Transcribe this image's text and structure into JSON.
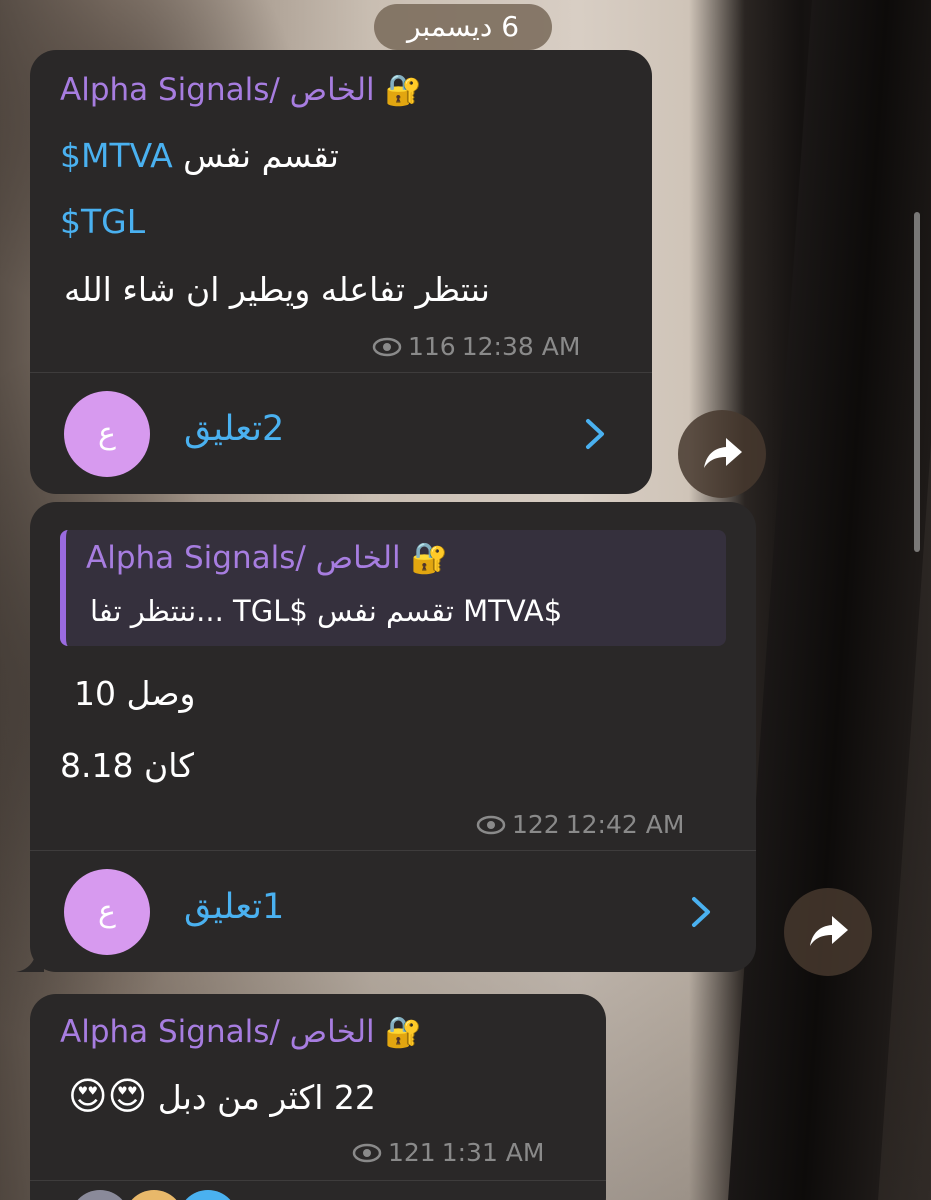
{
  "date_label": "6 ديسمبر",
  "messages": [
    {
      "sender": "Alpha Signals/ الخاص",
      "lines": [
        "تقسم نفس",
        "$MTVA",
        "$TGL",
        "ننتظر تفاعله ويطير ان شاء الله"
      ],
      "views": "116",
      "time": "12:38 AM",
      "comments_label": "2تعليق",
      "avatar_letter": "ع"
    },
    {
      "reply_sender": "Alpha Signals/ الخاص",
      "reply_text": "$MTVA تقسم نفس $TGL ...ننتظر تفا",
      "lines": [
        "وصل 10",
        "كان 8.18"
      ],
      "views": "122",
      "time": "12:42 AM",
      "comments_label": "1تعليق",
      "avatar_letter": "ع"
    },
    {
      "sender": "Alpha Signals/ الخاص",
      "text": "22 اكثر من دبل",
      "emoji": "😍😍",
      "views": "121",
      "time": "1:31 AM"
    }
  ],
  "icons": {
    "lock": "lock-with-key-icon",
    "eye": "eye-icon",
    "share": "share-arrow-icon",
    "chevron": "chevron-right-icon"
  },
  "colors": {
    "bubble": "#2a2828",
    "sender": "#a77de0",
    "link": "#4ab1f0",
    "avatar": "#d79aef",
    "meta": "#8a8a8a"
  }
}
